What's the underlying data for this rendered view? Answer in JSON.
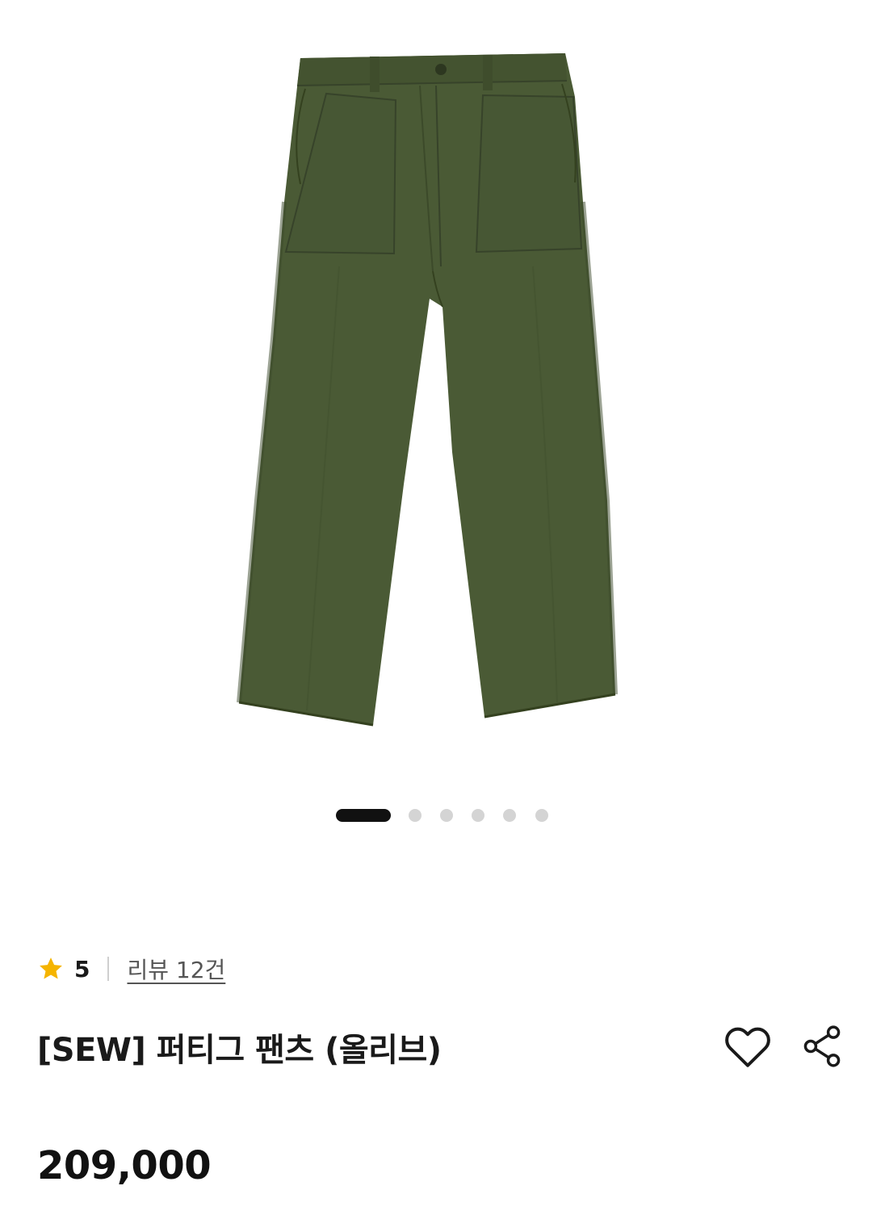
{
  "product": {
    "image_alt": "[SEW] 퍼티그 팬츠 (올리브)",
    "colors": {
      "fabric": "#4a5a35",
      "fabric_dark": "#3a4829",
      "fabric_shadow": "#34411f",
      "background": "#ffffff"
    },
    "image_pager": {
      "total": 6,
      "current": 1
    },
    "rating": {
      "score": "5",
      "review_label": "리뷰 12건",
      "star_color": "#f5b400"
    },
    "title": "[SEW] 퍼티그 팬츠 (올리브)",
    "price": "209,000"
  },
  "icons": {
    "rating": "star-icon",
    "like": "heart-icon",
    "share": "share-icon"
  }
}
